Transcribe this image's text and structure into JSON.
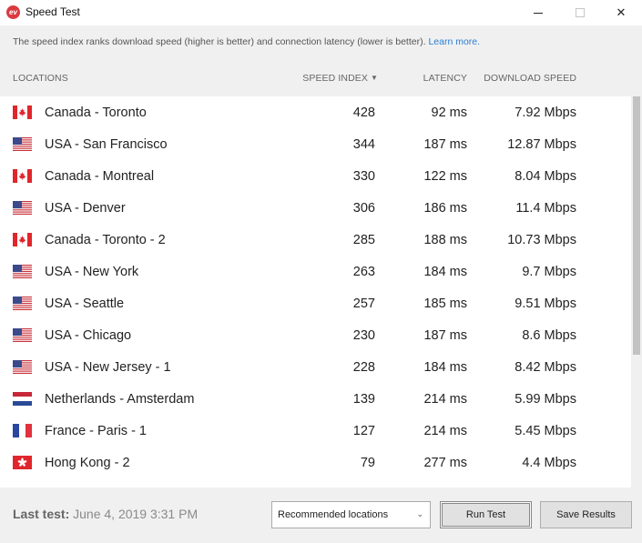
{
  "window": {
    "title": "Speed Test",
    "app_icon_glyph": "ev",
    "accent_color": "#da3940"
  },
  "info": {
    "text": "The speed index ranks download speed (higher is better) and connection latency (lower is better).",
    "link": "Learn more."
  },
  "columns": {
    "locations": "LOCATIONS",
    "speed_index": "SPEED INDEX",
    "latency": "LATENCY",
    "download_speed": "DOWNLOAD SPEED",
    "sort_indicator": "▼"
  },
  "rows": [
    {
      "flag": "canada-flag-icon",
      "location": "Canada - Toronto",
      "speed_index": "428",
      "latency": "92 ms",
      "download": "7.92 Mbps"
    },
    {
      "flag": "usa-flag-icon",
      "location": "USA - San Francisco",
      "speed_index": "344",
      "latency": "187 ms",
      "download": "12.87 Mbps"
    },
    {
      "flag": "canada-flag-icon",
      "location": "Canada - Montreal",
      "speed_index": "330",
      "latency": "122 ms",
      "download": "8.04 Mbps"
    },
    {
      "flag": "usa-flag-icon",
      "location": "USA - Denver",
      "speed_index": "306",
      "latency": "186 ms",
      "download": "11.4 Mbps"
    },
    {
      "flag": "canada-flag-icon",
      "location": "Canada - Toronto - 2",
      "speed_index": "285",
      "latency": "188 ms",
      "download": "10.73 Mbps"
    },
    {
      "flag": "usa-flag-icon",
      "location": "USA - New York",
      "speed_index": "263",
      "latency": "184 ms",
      "download": "9.7 Mbps"
    },
    {
      "flag": "usa-flag-icon",
      "location": "USA - Seattle",
      "speed_index": "257",
      "latency": "185 ms",
      "download": "9.51 Mbps"
    },
    {
      "flag": "usa-flag-icon",
      "location": "USA - Chicago",
      "speed_index": "230",
      "latency": "187 ms",
      "download": "8.6 Mbps"
    },
    {
      "flag": "usa-flag-icon",
      "location": "USA - New Jersey - 1",
      "speed_index": "228",
      "latency": "184 ms",
      "download": "8.42 Mbps"
    },
    {
      "flag": "netherlands-flag-icon",
      "location": "Netherlands - Amsterdam",
      "speed_index": "139",
      "latency": "214 ms",
      "download": "5.99 Mbps"
    },
    {
      "flag": "france-flag-icon",
      "location": "France - Paris - 1",
      "speed_index": "127",
      "latency": "214 ms",
      "download": "5.45 Mbps"
    },
    {
      "flag": "hongkong-flag-icon",
      "location": "Hong Kong - 2",
      "speed_index": "79",
      "latency": "277 ms",
      "download": "4.4 Mbps"
    }
  ],
  "footer": {
    "last_test_label": "Last test:",
    "last_test_value": "June 4, 2019 3:31 PM",
    "location_select": "Recommended locations",
    "run_test": "Run Test",
    "save_results": "Save Results"
  }
}
